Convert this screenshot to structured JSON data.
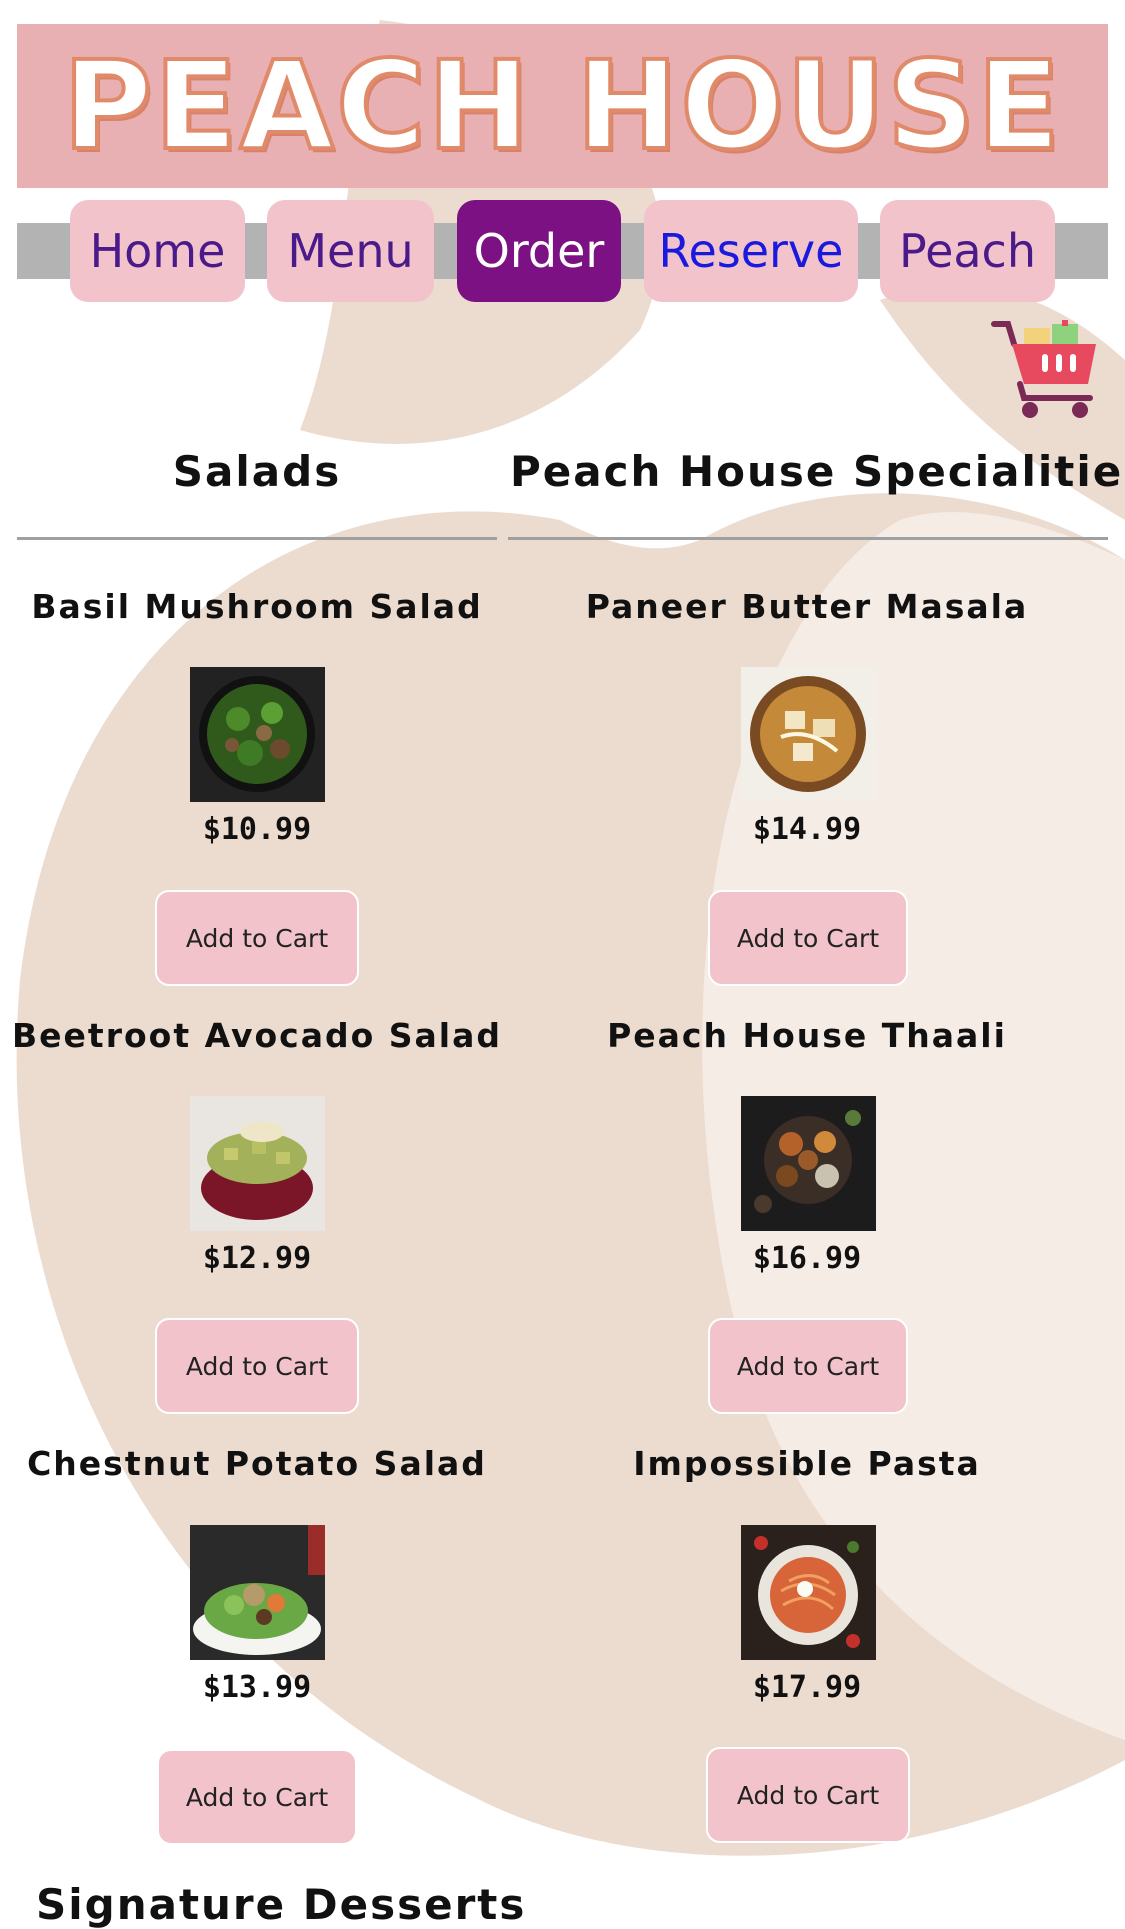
{
  "brand": {
    "banner_text": "PEACH HOUSE"
  },
  "nav": {
    "home": "Home",
    "menu": "Menu",
    "order": "Order",
    "reserve": "Reserve",
    "peach": "Peach",
    "active": "Order"
  },
  "cart": {
    "icon": "shopping-cart-icon"
  },
  "sections": {
    "salads": {
      "title": "Salads",
      "items": [
        {
          "name": "Basil Mushroom Salad",
          "price": "$10.99",
          "button": "Add to Cart",
          "image": "mushroom-salad-photo"
        },
        {
          "name": "Beetroot Avocado Salad",
          "price": "$12.99",
          "button": "Add to Cart",
          "image": "beetroot-avocado-photo"
        },
        {
          "name": "Chestnut Potato Salad",
          "price": "$13.99",
          "button": "Add to Cart",
          "image": "potato-salad-photo"
        }
      ]
    },
    "specialities": {
      "title": "Peach House Specialities",
      "items": [
        {
          "name": "Paneer Butter Masala",
          "price": "$14.99",
          "button": "Add to Cart",
          "image": "paneer-masala-photo"
        },
        {
          "name": "Peach House Thaali",
          "price": "$16.99",
          "button": "Add to Cart",
          "image": "thaali-photo"
        },
        {
          "name": "Impossible Pasta",
          "price": "$17.99",
          "button": "Add to Cart",
          "image": "pasta-photo"
        }
      ]
    },
    "next": {
      "title": "Signature Desserts"
    }
  },
  "colors": {
    "banner_bg": "#e8b0b3",
    "nav_bar": "#b3b3b3",
    "nav_pill": "#f3c3cc",
    "nav_active": "#7b1183",
    "nav_text": "#4b1a8a",
    "reserve_text": "#1a1adf",
    "peach_watermark": "#ecdcd0"
  }
}
